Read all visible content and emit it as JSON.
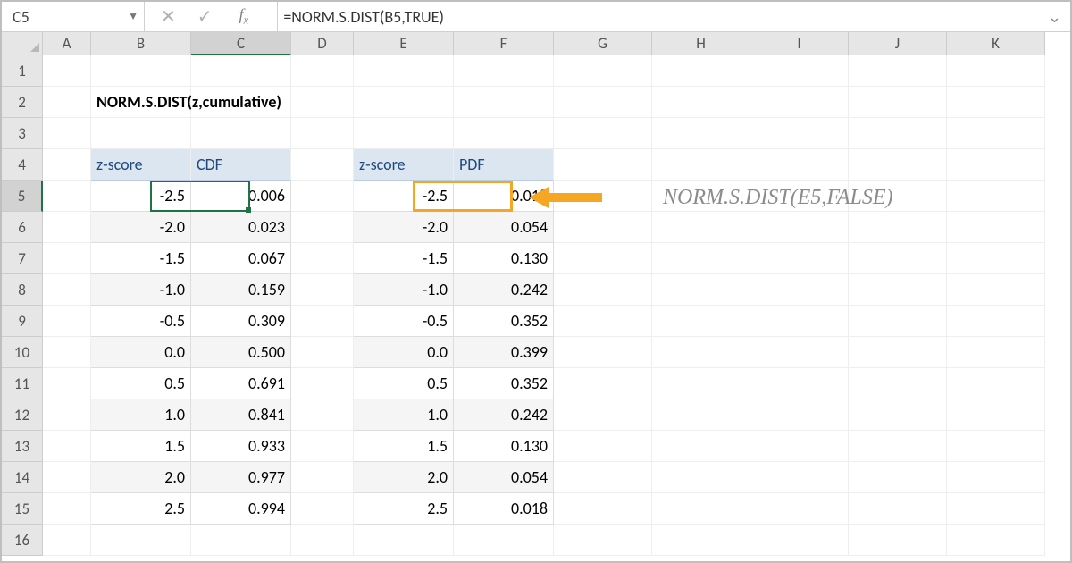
{
  "namebox": "C5",
  "formula": "=NORM.S.DIST(B5,TRUE)",
  "title": "NORM.S.DIST(z,cumulative)",
  "annotation": "NORM.S.DIST(E5,FALSE)",
  "columns": [
    "A",
    "B",
    "C",
    "D",
    "E",
    "F",
    "G",
    "H",
    "I",
    "J",
    "K"
  ],
  "rows": [
    "1",
    "2",
    "3",
    "4",
    "5",
    "6",
    "7",
    "8",
    "9",
    "10",
    "11",
    "12",
    "13",
    "14",
    "15",
    "16"
  ],
  "headers1": {
    "z": "z-score",
    "v": "CDF"
  },
  "headers2": {
    "z": "z-score",
    "v": "PDF"
  },
  "data1": [
    {
      "z": "-2.5",
      "v": "0.006"
    },
    {
      "z": "-2.0",
      "v": "0.023"
    },
    {
      "z": "-1.5",
      "v": "0.067"
    },
    {
      "z": "-1.0",
      "v": "0.159"
    },
    {
      "z": "-0.5",
      "v": "0.309"
    },
    {
      "z": "0.0",
      "v": "0.500"
    },
    {
      "z": "0.5",
      "v": "0.691"
    },
    {
      "z": "1.0",
      "v": "0.841"
    },
    {
      "z": "1.5",
      "v": "0.933"
    },
    {
      "z": "2.0",
      "v": "0.977"
    },
    {
      "z": "2.5",
      "v": "0.994"
    }
  ],
  "data2": [
    {
      "z": "-2.5",
      "v": "0.018"
    },
    {
      "z": "-2.0",
      "v": "0.054"
    },
    {
      "z": "-1.5",
      "v": "0.130"
    },
    {
      "z": "-1.0",
      "v": "0.242"
    },
    {
      "z": "-0.5",
      "v": "0.352"
    },
    {
      "z": "0.0",
      "v": "0.399"
    },
    {
      "z": "0.5",
      "v": "0.352"
    },
    {
      "z": "1.0",
      "v": "0.242"
    },
    {
      "z": "1.5",
      "v": "0.130"
    },
    {
      "z": "2.0",
      "v": "0.054"
    },
    {
      "z": "2.5",
      "v": "0.018"
    }
  ]
}
